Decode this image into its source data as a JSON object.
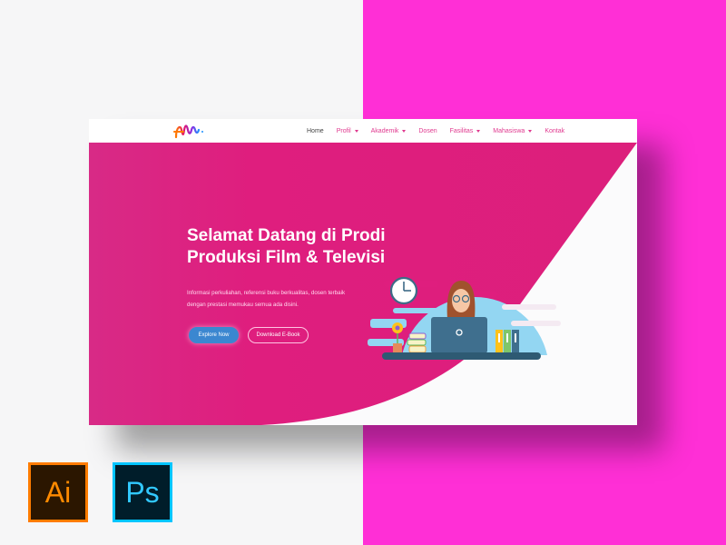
{
  "colors": {
    "page_bg": "#f6f6f7",
    "magenta_panel": "#ff2fd6",
    "hero_pink": "#df1e7e",
    "nav_link": "#e0398f",
    "explore_button": "#3b87d0",
    "ai_orange": "#ff7c00",
    "ps_blue": "#00c5ff"
  },
  "navbar": {
    "logo_icon": "wave-logo-icon",
    "items": [
      {
        "label": "Home",
        "dropdown": false,
        "active": true
      },
      {
        "label": "Profil",
        "dropdown": true
      },
      {
        "label": "Akademik",
        "dropdown": true
      },
      {
        "label": "Dosen",
        "dropdown": false
      },
      {
        "label": "Fasilitas",
        "dropdown": true
      },
      {
        "label": "Mahasiswa",
        "dropdown": true
      },
      {
        "label": "Kontak",
        "dropdown": false
      }
    ]
  },
  "hero": {
    "title_line1": "Selamat Datang di Prodi",
    "title_line2": "Produksi Film & Televisi",
    "sub_line1": "Informasi perkuliahan, referensi buku berkualitas, dosen terbaik",
    "sub_line2": "dengan prestasi memukau semua ada disini.",
    "primary_button": "Explore Now",
    "secondary_button": "Download E-Book",
    "illustration": "woman-at-laptop-illustration"
  },
  "tool_icons": [
    {
      "name": "illustrator-icon",
      "label": "Ai"
    },
    {
      "name": "photoshop-icon",
      "label": "Ps"
    }
  ]
}
